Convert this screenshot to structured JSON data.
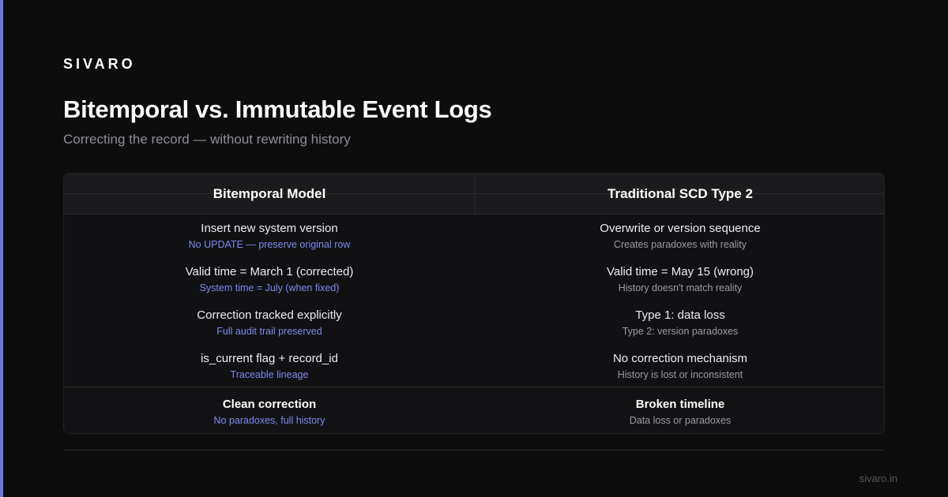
{
  "brand": "SIVARO",
  "title": "Bitemporal vs. Immutable Event Logs",
  "subtitle": "Correcting the record — without rewriting history",
  "table": {
    "headers": [
      "Bitemporal Model",
      "Traditional SCD Type 2"
    ],
    "rows": [
      {
        "left": {
          "main": "Insert new system version",
          "sub": "No UPDATE — preserve original row"
        },
        "right": {
          "main": "Overwrite or version sequence",
          "sub": "Creates paradoxes with reality"
        }
      },
      {
        "left": {
          "main": "Valid time = March 1 (corrected)",
          "sub": "System time = July (when fixed)"
        },
        "right": {
          "main": "Valid time = May 15 (wrong)",
          "sub": "History doesn't match reality"
        }
      },
      {
        "left": {
          "main": "Correction tracked explicitly",
          "sub": "Full audit trail preserved"
        },
        "right": {
          "main": "Type 1: data loss",
          "sub": "Type 2: version paradoxes"
        }
      },
      {
        "left": {
          "main": "is_current flag + record_id",
          "sub": "Traceable lineage"
        },
        "right": {
          "main": "No correction mechanism",
          "sub": "History is lost or inconsistent"
        }
      }
    ],
    "summary": {
      "left": {
        "main": "Clean correction",
        "sub": "No paradoxes, full history"
      },
      "right": {
        "main": "Broken timeline",
        "sub": "Data loss or paradoxes"
      }
    }
  },
  "footer": {
    "url": "sivaro.in"
  },
  "colors": {
    "background": "#0d0d0e",
    "accent": "#6b78e6",
    "accent_text": "#7e89ef",
    "muted_text": "#9a9ca3"
  }
}
